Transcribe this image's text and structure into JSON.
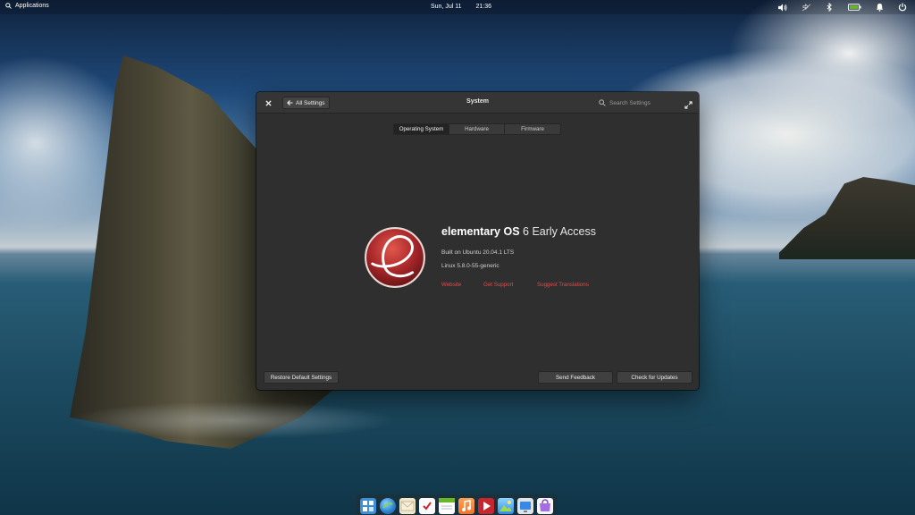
{
  "panel": {
    "applications_label": "Applications",
    "date": "Sun, Jul 11",
    "time": "21:36",
    "tray_icons": [
      "volume-icon",
      "network-icon",
      "bluetooth-icon",
      "battery-icon",
      "notifications-icon",
      "power-icon"
    ]
  },
  "window": {
    "title": "System",
    "back_label": "All Settings",
    "search_placeholder": "Search Settings",
    "tabs": [
      {
        "label": "Operating System",
        "active": true
      },
      {
        "label": "Hardware",
        "active": false
      },
      {
        "label": "Firmware",
        "active": false
      }
    ],
    "os": {
      "name_bold": "elementary OS",
      "name_rest": "6 Early Access",
      "built_on": "Built on Ubuntu 20.04.1 LTS",
      "kernel": "Linux 5.8.0-55-generic",
      "links": [
        "Website",
        "Get Support",
        "Suggest Translations"
      ]
    },
    "buttons": {
      "restore": "Restore Default Settings",
      "feedback": "Send Feedback",
      "updates": "Check for Updates"
    }
  },
  "dock": {
    "items": [
      "multitasking-view",
      "web-browser",
      "mail",
      "tasks",
      "calendar",
      "music",
      "videos",
      "photos",
      "settings",
      "app-center"
    ]
  },
  "colors": {
    "link": "#e44a4a",
    "window_bg": "#2f2f2f",
    "active_tab": "#232323"
  }
}
